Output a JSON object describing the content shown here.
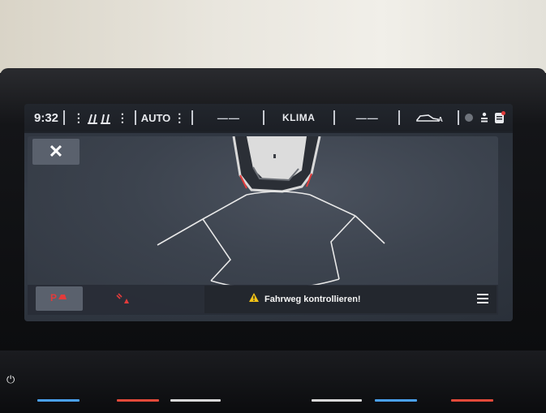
{
  "status_bar": {
    "time": "9:32",
    "seat_icon": "seat-heating-icon",
    "climate_mode": "AUTO",
    "left_temp": "——",
    "klima_label": "KLIMA",
    "right_temp": "——",
    "car_icon": "car-auto-icon",
    "extra_icons": [
      "circle-icon",
      "person-stack-icon",
      "notification-icon"
    ]
  },
  "parking": {
    "close_icon": "close-icon",
    "park_button_icon": "park-assist-icon",
    "sensor_button_icon": "sensor-warning-icon",
    "warning_text": "Fahrweg kontrollieren!",
    "warning_icon": "warning-triangle-icon",
    "menu_icon": "menu-icon"
  },
  "colors": {
    "accent_red": "#e23b3b",
    "warning_yellow": "#f4c316",
    "screen_bg": "#1e2229",
    "bottom_bar": "#2a2f37"
  }
}
